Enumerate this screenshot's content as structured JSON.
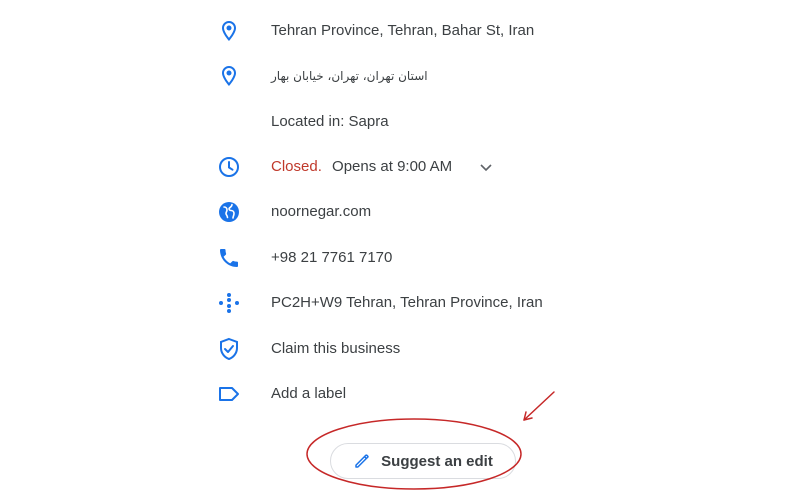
{
  "colors": {
    "icon_blue": "#1a73e8",
    "text": "#3c4043",
    "closed_red": "#c0392b",
    "annotation_red": "#c62828"
  },
  "info_rows": [
    {
      "icon": "location-pin-icon",
      "text": "Tehran Province, Tehran, Bahar St, Iran"
    },
    {
      "icon": "location-pin-icon",
      "text": "استان تهران، تهران، خیابان بهار"
    },
    {
      "icon": "",
      "text": "Located in: Sapra"
    },
    {
      "icon": "clock-icon",
      "status": "Closed.",
      "text": "Opens at 9:00 AM",
      "expand_icon": "chevron-down-icon"
    },
    {
      "icon": "globe-icon",
      "text": "noornegar.com"
    },
    {
      "icon": "phone-icon",
      "text": "+98 21 7761 7170"
    },
    {
      "icon": "plus-code-icon",
      "text": "PC2H+W9 Tehran, Tehran Province, Iran"
    },
    {
      "icon": "verified-shield-icon",
      "text": "Claim this business"
    },
    {
      "icon": "label-icon",
      "text": "Add a label"
    }
  ],
  "suggest_edit": {
    "icon": "pencil-icon",
    "label": "Suggest an edit"
  }
}
